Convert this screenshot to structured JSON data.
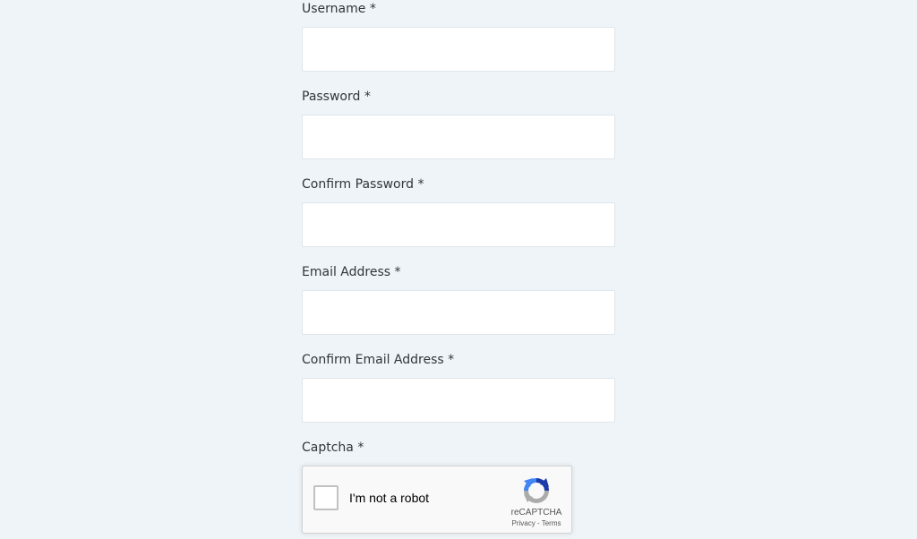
{
  "form": {
    "fields": [
      {
        "label": "Username *",
        "value": "",
        "placeholder": ""
      },
      {
        "label": "Password *",
        "value": "",
        "placeholder": ""
      },
      {
        "label": "Confirm Password *",
        "value": "",
        "placeholder": ""
      },
      {
        "label": "Email Address *",
        "value": "",
        "placeholder": ""
      },
      {
        "label": "Confirm Email Address *",
        "value": "",
        "placeholder": ""
      }
    ],
    "captcha_label": "Captcha *"
  },
  "recaptcha": {
    "checkbox_label": "I'm not a robot",
    "brand": "reCAPTCHA",
    "privacy": "Privacy",
    "separator": " - ",
    "terms": "Terms",
    "logo_icon": "recaptcha-logo-icon",
    "logo_colors": [
      "#1c3aa9",
      "#4285f4",
      "#ababab"
    ]
  },
  "theme": {
    "background": "#eef4f7",
    "input_background": "#ffffff",
    "input_border": "#dfe5e9"
  }
}
